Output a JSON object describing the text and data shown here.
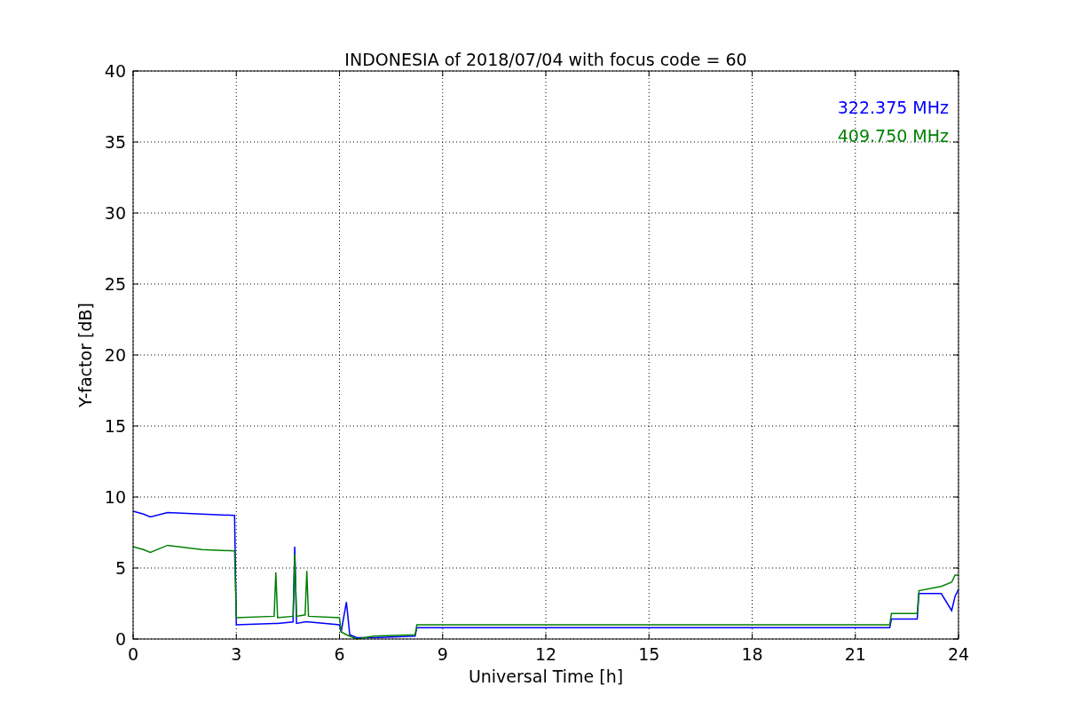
{
  "figure": {
    "chart_data": {
      "type": "line",
      "title": "INDONESIA of 2018/07/04 with focus code = 60",
      "xlabel": "Universal Time [h]",
      "ylabel": "Y-factor [dB]",
      "x": [
        0,
        0.3,
        0.5,
        1,
        2,
        2.95,
        3.0,
        4.1,
        4.15,
        4.2,
        4.65,
        4.7,
        4.75,
        5.0,
        5.05,
        5.1,
        6.0,
        6.05,
        6.2,
        6.3,
        6.5,
        7,
        8.2,
        8.25,
        22,
        22.05,
        22.8,
        22.85,
        23.5,
        23.8,
        23.9,
        24
      ],
      "series": [
        {
          "name": "322.375 MHz",
          "color": "#0000ff",
          "values": [
            9.0,
            8.8,
            8.6,
            8.9,
            8.8,
            8.7,
            1.0,
            1.1,
            1.1,
            1.1,
            1.2,
            6.5,
            1.1,
            1.2,
            1.2,
            1.2,
            1.0,
            0.5,
            2.6,
            0.3,
            0.1,
            0.1,
            0.2,
            0.8,
            0.8,
            1.4,
            1.4,
            3.2,
            3.2,
            2.0,
            3.0,
            3.5
          ]
        },
        {
          "name": "409.750 MHz",
          "color": "#008000",
          "values": [
            6.5,
            6.3,
            6.1,
            6.6,
            6.3,
            6.2,
            1.5,
            1.6,
            4.7,
            1.5,
            1.6,
            6.0,
            1.6,
            1.7,
            4.8,
            1.6,
            1.5,
            0.5,
            0.3,
            0.2,
            0.0,
            0.2,
            0.3,
            1.0,
            1.0,
            1.8,
            1.8,
            3.4,
            3.7,
            4.0,
            4.5,
            4.5
          ]
        }
      ],
      "grid": true,
      "xlim": [
        0,
        24
      ],
      "ylim": [
        0,
        40
      ],
      "xticks": [
        0,
        3,
        6,
        9,
        12,
        15,
        18,
        21,
        24
      ],
      "yticks": [
        0,
        5,
        10,
        15,
        20,
        25,
        30,
        35,
        40
      ]
    }
  }
}
